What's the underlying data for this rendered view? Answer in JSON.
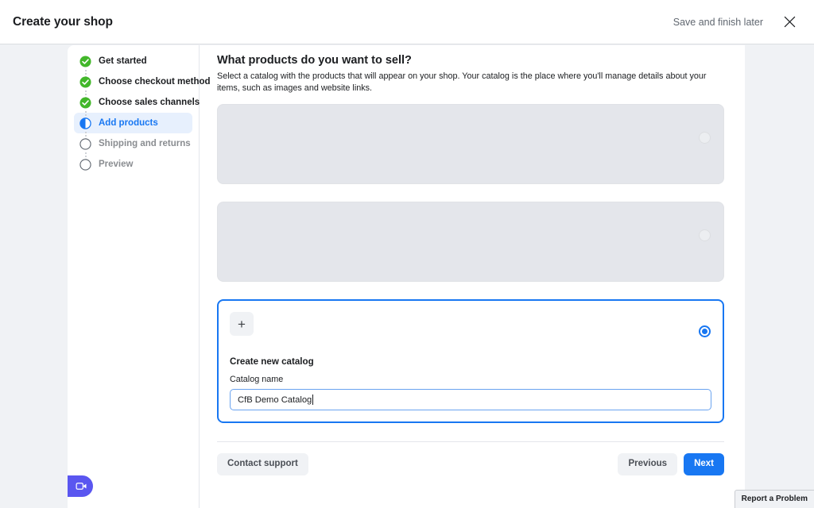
{
  "topbar": {
    "title": "Create your shop",
    "save_later_label": "Save and finish later",
    "close_icon": "close-icon"
  },
  "sidebar": {
    "items": [
      {
        "label": "Get started",
        "state": "complete",
        "icon": "check-circle-icon"
      },
      {
        "label": "Choose checkout method",
        "state": "complete",
        "icon": "check-circle-icon"
      },
      {
        "label": "Choose sales channels",
        "state": "complete",
        "icon": "check-circle-icon"
      },
      {
        "label": "Add products",
        "state": "active",
        "icon": "half-circle-icon"
      },
      {
        "label": "Shipping and returns",
        "state": "pending",
        "icon": "empty-circle-icon"
      },
      {
        "label": "Preview",
        "state": "pending",
        "icon": "empty-circle-icon"
      }
    ]
  },
  "main": {
    "heading": "What products do you want to sell?",
    "description": "Select a catalog with the products that will appear on your shop. Your catalog is the place where you'll manage details about your items, such as images and website links.",
    "options": [
      {
        "type": "skeleton",
        "selected": false,
        "label": ""
      },
      {
        "type": "skeleton",
        "selected": false,
        "label": ""
      },
      {
        "type": "create",
        "selected": true,
        "plus_icon": "plus-icon",
        "title": "Create new catalog",
        "field_label": "Catalog name",
        "field_value": "CfB Demo Catalog",
        "field_placeholder": "Catalog name"
      }
    ]
  },
  "footer": {
    "contact_support_label": "Contact support",
    "previous_label": "Previous",
    "next_label": "Next"
  },
  "overlays": {
    "fab_icon": "video-camera-icon",
    "report_problem_label": "Report a Problem"
  },
  "colors": {
    "accent_blue": "#1877f2",
    "success_green": "#42b72a",
    "fab_purple": "#5a56f0",
    "skeleton_gray": "#e4e6eb"
  }
}
